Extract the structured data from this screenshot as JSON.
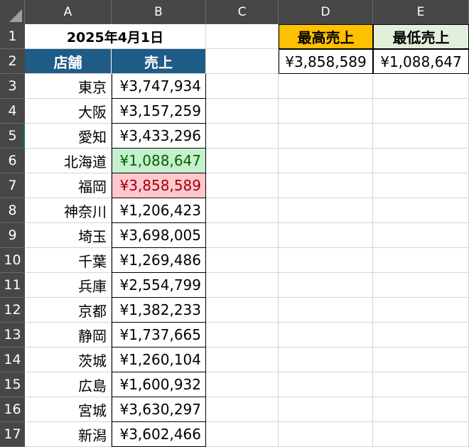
{
  "columns": [
    "A",
    "B",
    "C",
    "D",
    "E"
  ],
  "rows": [
    "1",
    "2",
    "3",
    "4",
    "5",
    "6",
    "7",
    "8",
    "9",
    "10",
    "11",
    "12",
    "13",
    "14",
    "15",
    "16",
    "17"
  ],
  "title": "2025年4月1日",
  "table_header": {
    "store": "店舗",
    "sales": "売上"
  },
  "stores": [
    {
      "name": "東京",
      "sales": "¥3,747,934"
    },
    {
      "name": "大阪",
      "sales": "¥3,157,259"
    },
    {
      "name": "愛知",
      "sales": "¥3,433,296"
    },
    {
      "name": "北海道",
      "sales": "¥1,088,647"
    },
    {
      "name": "福岡",
      "sales": "¥3,858,589"
    },
    {
      "name": "神奈川",
      "sales": "¥1,206,423"
    },
    {
      "name": "埼玉",
      "sales": "¥3,698,005"
    },
    {
      "name": "千葉",
      "sales": "¥1,269,486"
    },
    {
      "name": "兵庫",
      "sales": "¥2,554,799"
    },
    {
      "name": "京都",
      "sales": "¥1,382,233"
    },
    {
      "name": "静岡",
      "sales": "¥1,737,665"
    },
    {
      "name": "茨城",
      "sales": "¥1,260,104"
    },
    {
      "name": "広島",
      "sales": "¥1,600,932"
    },
    {
      "name": "宮城",
      "sales": "¥3,630,297"
    },
    {
      "name": "新潟",
      "sales": "¥3,602,466"
    }
  ],
  "summary": {
    "max_label": "最高売上",
    "min_label": "最低売上",
    "max_value": "¥3,858,589",
    "min_value": "¥1,088,647"
  },
  "colors": {
    "header_bg": "#1f5c87",
    "max_header_bg": "#ffc000",
    "min_header_bg": "#e2efda",
    "max_cell_bg": "#ffc7ce",
    "max_cell_text": "#9c0006",
    "min_cell_bg": "#c6efce",
    "min_cell_text": "#006100",
    "sheet_header_bg": "#474747"
  },
  "highlight": {
    "max_store_index": 4,
    "min_store_index": 3
  }
}
